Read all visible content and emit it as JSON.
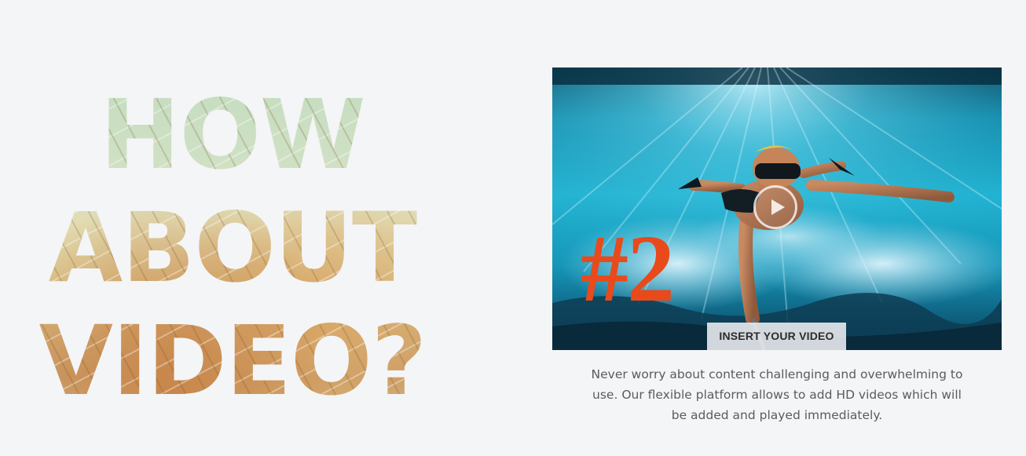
{
  "headline": {
    "lines": [
      "HOW",
      "ABOUT",
      "VIDEO?"
    ]
  },
  "video": {
    "badge_text": "#2",
    "badge_color": "#e84a1c",
    "play_icon": "play-circle-icon",
    "insert_button_label": "INSERT YOUR VIDEO"
  },
  "description": {
    "text": "Never worry about content challenging and overwhelming to use. Our flexible platform allows to add HD videos which will be added and played immediately."
  },
  "colors": {
    "page_background": "#f4f5f7",
    "description_text": "#5b5b5b",
    "water_primary": "#1aa9c9",
    "water_deep": "#0b4c6a"
  }
}
